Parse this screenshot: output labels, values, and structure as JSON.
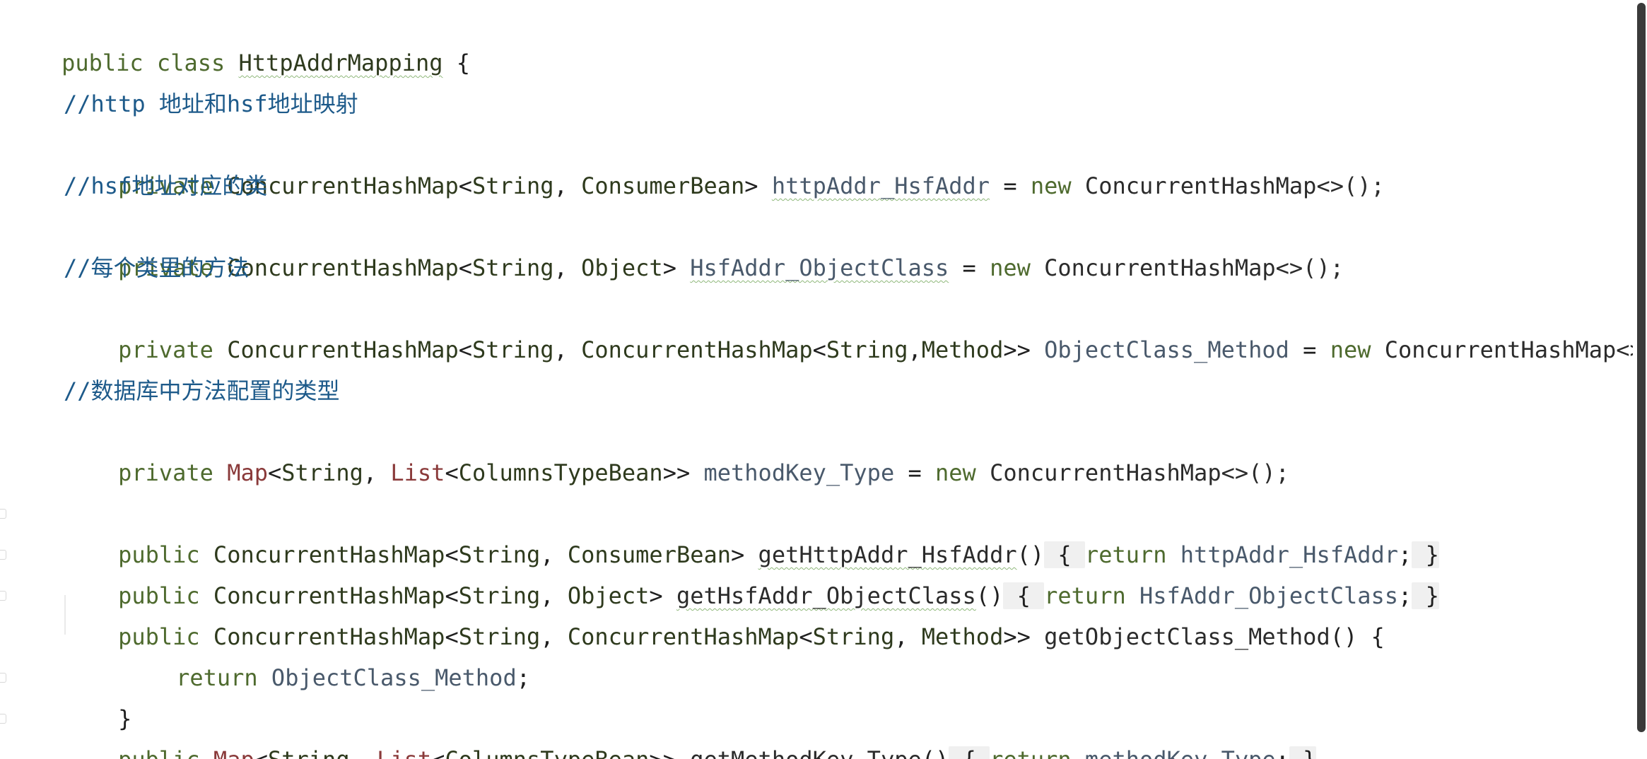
{
  "code": {
    "l1": {
      "kw1": "public",
      "kw2": "class",
      "name": "HttpAddrMapping",
      "brace": "{"
    },
    "c1": "//http 地址和hsf地址映射",
    "l2": {
      "kw": "private",
      "type": "ConcurrentHashMap",
      "lt": "<",
      "k": "String",
      "comma": ",",
      "v": "ConsumerBean",
      "gt": ">",
      "field": "httpAddr_HsfAddr",
      "eq": "=",
      "new": "new",
      "ctor": "ConcurrentHashMap<>();"
    },
    "c2": "//hsf地址对应的类",
    "l3": {
      "kw": "private",
      "type": "ConcurrentHashMap",
      "lt": "<",
      "k": "String",
      "comma": ",",
      "v": "Object",
      "gt": ">",
      "field": "HsfAddr_ObjectClass",
      "eq": "=",
      "new": "new",
      "ctor": "ConcurrentHashMap<>();"
    },
    "c3": "//每个类里的方法",
    "l4": {
      "kw": "private",
      "type": "ConcurrentHashMap",
      "lt": "<",
      "k": "String",
      "comma": ",",
      "v": "ConcurrentHashMap",
      "lt2": "<",
      "k2": "String",
      "comma2": ",",
      "v2": "Method",
      "gt": ">>",
      "field": "ObjectClass_Method",
      "eq": "=",
      "new": "new",
      "ctor": "ConcurrentHashMap<>"
    },
    "c4": "//数据库中方法配置的类型",
    "l5": {
      "kw": "private",
      "type": "Map",
      "lt": "<",
      "k": "String",
      "comma": ",",
      "v": "List",
      "lt2": "<",
      "v2": "ColumnsTypeBean",
      "gt": ">>",
      "field": "methodKey_Type",
      "eq": "=",
      "new": "new",
      "ctor": "ConcurrentHashMap<>();"
    },
    "m1": {
      "kw": "public",
      "type": "ConcurrentHashMap",
      "lt": "<",
      "k": "String",
      "comma": ",",
      "v": "ConsumerBean",
      "gt": ">",
      "name": "getHttpAddr_HsfAddr",
      "parens": "()",
      "ob": "{",
      "ret": "return",
      "field": "httpAddr_HsfAddr",
      "semi": ";",
      "cb": "}"
    },
    "m2": {
      "kw": "public",
      "type": "ConcurrentHashMap",
      "lt": "<",
      "k": "String",
      "comma": ",",
      "v": "Object",
      "gt": ">",
      "name": "getHsfAddr_ObjectClass",
      "parens": "()",
      "ob": "{",
      "ret": "return",
      "field": "HsfAddr_ObjectClass",
      "semi": ";",
      "cb": "}"
    },
    "m3": {
      "kw": "public",
      "type": "ConcurrentHashMap",
      "lt": "<",
      "k": "String",
      "comma": ",",
      "v": "ConcurrentHashMap",
      "lt2": "<",
      "k2": "String",
      "comma2": ",",
      "v2": "Method",
      "gt": ">>",
      "name": "getObjectClass_Method",
      "parens": "()",
      "ob": "{"
    },
    "m3body": {
      "ret": "return",
      "field": "ObjectClass_Method",
      "semi": ";"
    },
    "m3close": "}",
    "m4": {
      "kw": "public",
      "type": "Map",
      "lt": "<",
      "k": "String",
      "comma": ",",
      "v": "List",
      "lt2": "<",
      "v2": "ColumnsTypeBean",
      "gt": ">>",
      "name": "getMethodKey_Type",
      "parens": "()",
      "ob": "{",
      "ret": "return",
      "field": "methodKey_Type",
      "semi": ";",
      "cb": "}"
    }
  }
}
